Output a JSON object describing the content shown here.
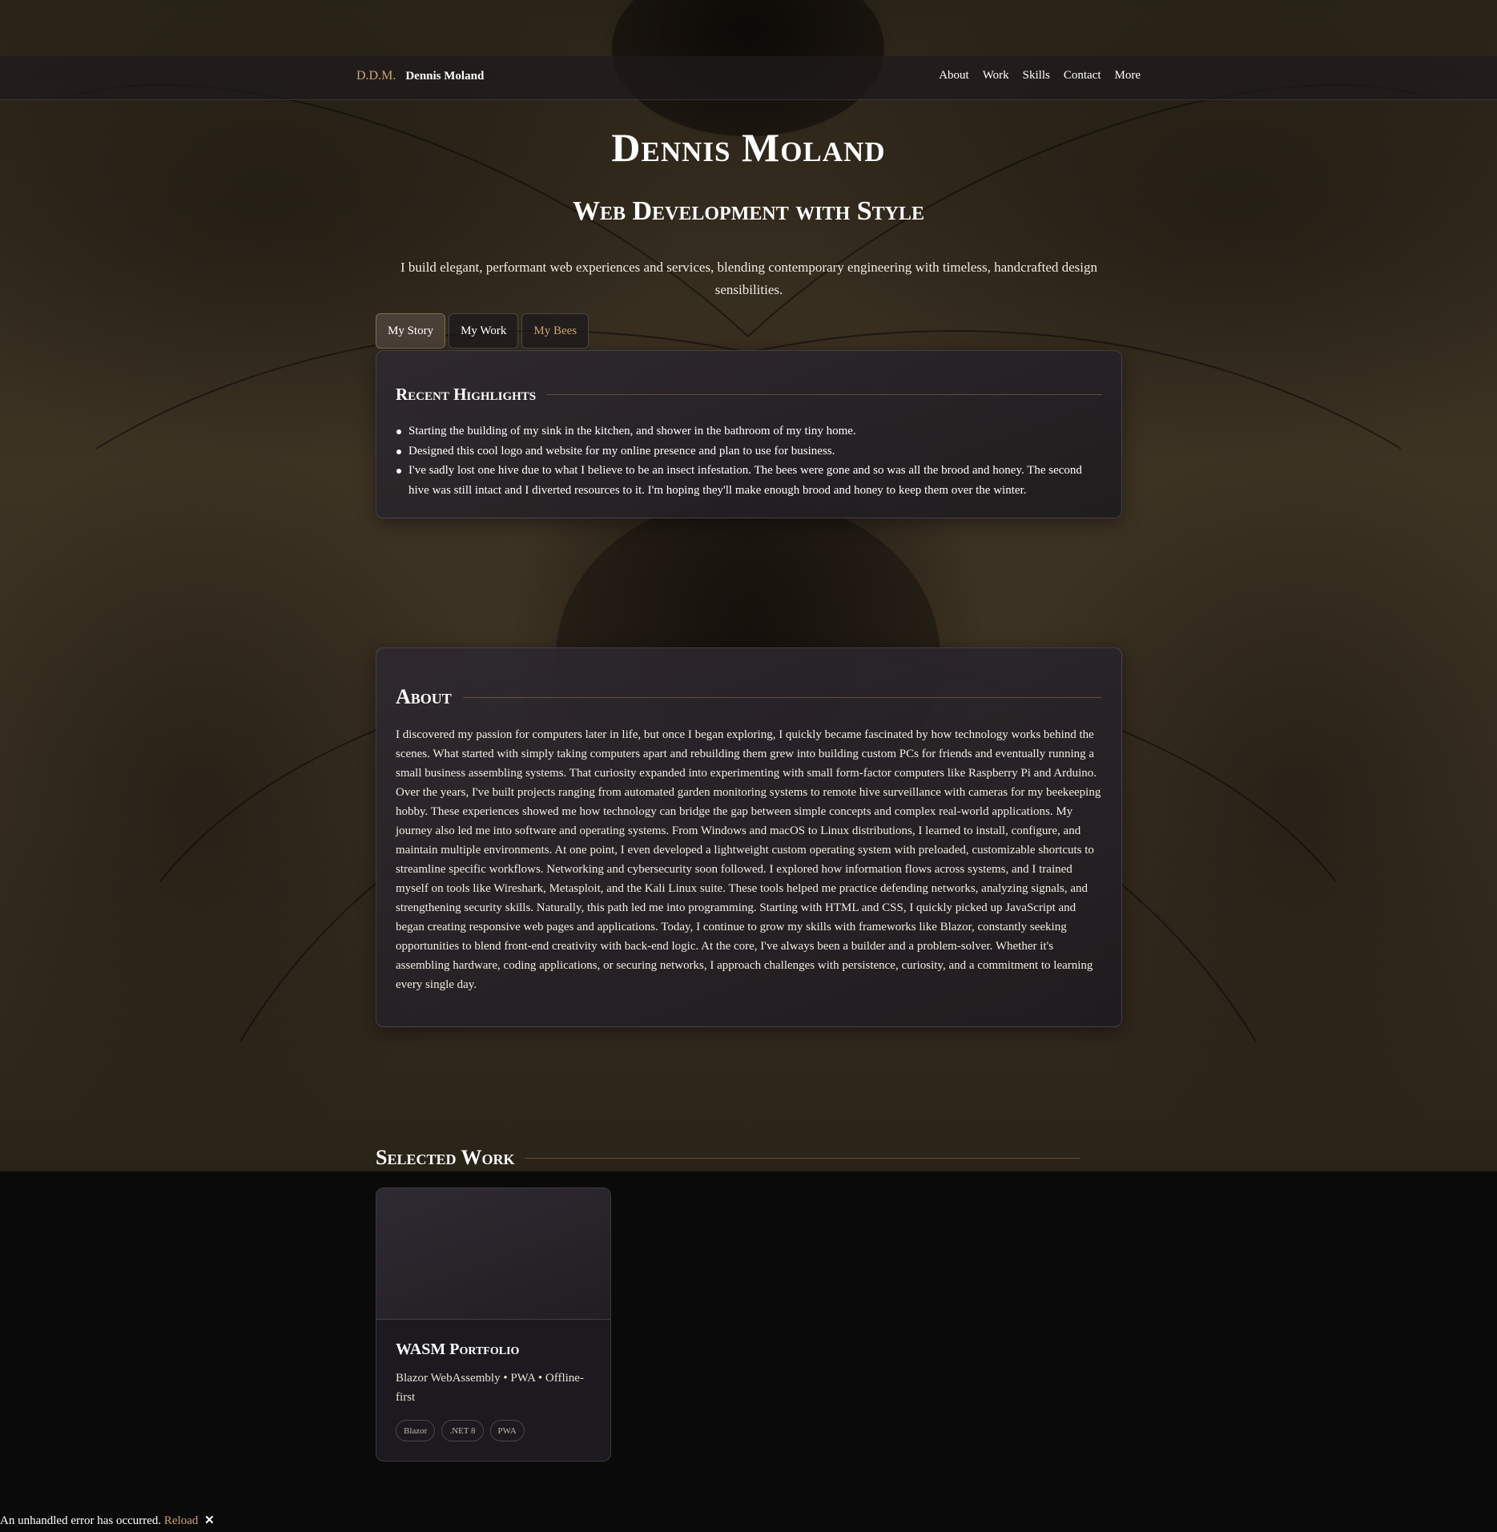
{
  "nav": {
    "brand_mark": "D.D.M.",
    "brand_name": "Dennis Moland",
    "links": [
      "About",
      "Work",
      "Skills",
      "Contact",
      "More"
    ]
  },
  "hero": {
    "title": "Dennis Moland",
    "subtitle": "Web Development with Style",
    "description": "I build elegant, performant web experiences and services, blending contemporary engineering with timeless, handcrafted design sensibilities."
  },
  "tabs": [
    "My Story",
    "My Work",
    "My Bees"
  ],
  "highlights": {
    "heading": "Recent Highlights",
    "items": [
      "Starting the building of my sink in the kitchen, and shower in the bathroom of my tiny home.",
      "Designed this cool logo and website for my online presence and plan to use for business.",
      "I've sadly lost one hive due to what I believe to be an insect infestation. The bees were gone and so was all the brood and honey. The second hive was still intact and I diverted resources to it. I'm hoping they'll make enough brood and honey to keep them over the winter."
    ]
  },
  "about": {
    "heading": "About",
    "body": "I discovered my passion for computers later in life, but once I began exploring, I quickly became fascinated by how technology works behind the scenes. What started with simply taking computers apart and rebuilding them grew into building custom PCs for friends and eventually running a small business assembling systems. That curiosity expanded into experimenting with small form-factor computers like Raspberry Pi and Arduino. Over the years, I've built projects ranging from automated garden monitoring systems to remote hive surveillance with cameras for my beekeeping hobby. These experiences showed me how technology can bridge the gap between simple concepts and complex real-world applications. My journey also led me into software and operating systems. From Windows and macOS to Linux distributions, I learned to install, configure, and maintain multiple environments. At one point, I even developed a lightweight custom operating system with preloaded, customizable shortcuts to streamline specific workflows. Networking and cybersecurity soon followed. I explored how information flows across systems, and I trained myself on tools like Wireshark, Metasploit, and the Kali Linux suite. These tools helped me practice defending networks, analyzing signals, and strengthening security skills. Naturally, this path led me into programming. Starting with HTML and CSS, I quickly picked up JavaScript and began creating responsive web pages and applications. Today, I continue to grow my skills with frameworks like Blazor, constantly seeking opportunities to blend front-end creativity with back-end logic. At the core, I've always been a builder and a problem-solver. Whether it's assembling hardware, coding applications, or securing networks, I approach challenges with persistence, curiosity, and a commitment to learning every single day."
  },
  "work": {
    "heading": "Selected Work",
    "projects": [
      {
        "title": "WASM Portfolio",
        "description": "Blazor WebAssembly • PWA • Offline-first",
        "tags": [
          "Blazor",
          ".NET 8",
          "PWA"
        ]
      }
    ]
  },
  "error_bar": {
    "message": "An unhandled error has occurred.",
    "reload": "Reload",
    "close": "✕"
  },
  "colors": {
    "accent_gold": "#c8a66e",
    "card_bg": "#26232a",
    "page_bg": "#0b0a0b"
  }
}
